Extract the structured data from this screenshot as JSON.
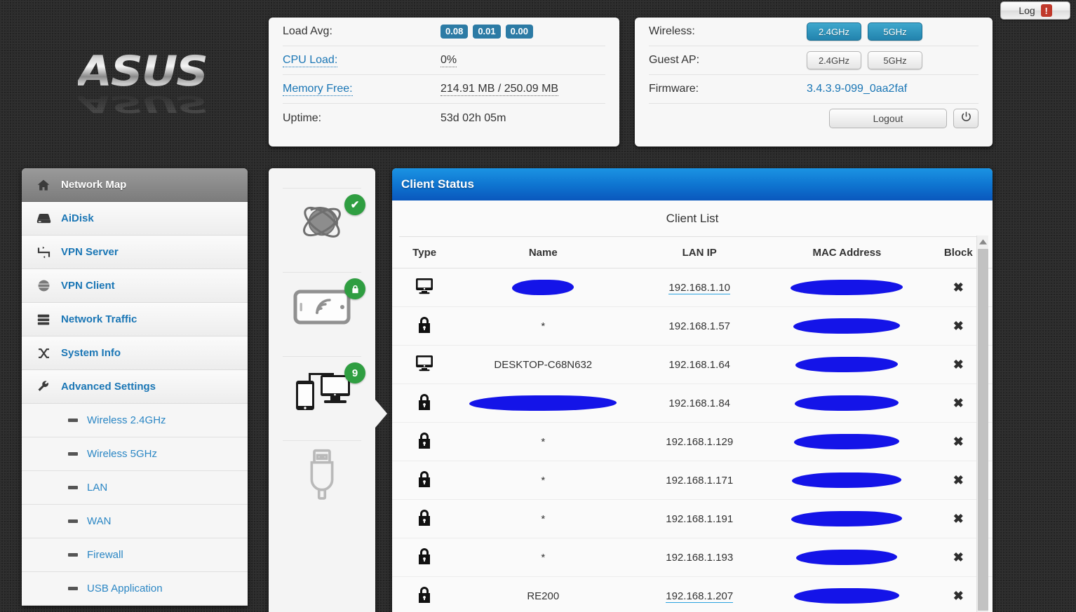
{
  "topbar": {
    "log_label": "Log",
    "log_badge": "!"
  },
  "brand": {
    "logo_text": "ASUS"
  },
  "status_panel": {
    "load_avg_label": "Load Avg:",
    "load_avg_values": [
      "0.08",
      "0.01",
      "0.00"
    ],
    "cpu_load_label": "CPU Load:",
    "cpu_load_value": "0%",
    "memory_label": "Memory Free:",
    "memory_value": "214.91 MB / 250.09 MB",
    "uptime_label": "Uptime:",
    "uptime_value": "53d 02h 05m"
  },
  "wireless_panel": {
    "wireless_label": "Wireless:",
    "wireless_bands": [
      {
        "label": "2.4GHz",
        "active": true
      },
      {
        "label": "5GHz",
        "active": true
      }
    ],
    "guest_label": "Guest AP:",
    "guest_bands": [
      {
        "label": "2.4GHz",
        "active": false
      },
      {
        "label": "5GHz",
        "active": false
      }
    ],
    "firmware_label": "Firmware:",
    "firmware_value": "3.4.3.9-099_0aa2faf",
    "logout_label": "Logout",
    "power_icon": "power-icon"
  },
  "sidebar": {
    "items": [
      {
        "label": "Network Map",
        "icon": "home-icon",
        "active": true
      },
      {
        "label": "AiDisk",
        "icon": "harddisk-icon",
        "active": false
      },
      {
        "label": "VPN Server",
        "icon": "vpn-server-icon",
        "active": false
      },
      {
        "label": "VPN Client",
        "icon": "globe-icon",
        "active": false
      },
      {
        "label": "Network Traffic",
        "icon": "traffic-icon",
        "active": false
      },
      {
        "label": "System Info",
        "icon": "shuffle-icon",
        "active": false
      },
      {
        "label": "Advanced Settings",
        "icon": "wrench-icon",
        "active": false
      }
    ],
    "sub_items": [
      {
        "label": "Wireless 2.4GHz"
      },
      {
        "label": "Wireless 5GHz"
      },
      {
        "label": "LAN"
      },
      {
        "label": "WAN"
      },
      {
        "label": "Firewall"
      },
      {
        "label": "USB Application"
      }
    ]
  },
  "topology": {
    "nodes": [
      {
        "icon": "internet-globe-icon",
        "badge": "✔",
        "badge_type": "check"
      },
      {
        "icon": "wireless-router-icon",
        "badge": "lock",
        "badge_type": "lock"
      },
      {
        "icon": "clients-devices-icon",
        "badge": "9",
        "badge_type": "count"
      },
      {
        "icon": "usb-icon",
        "badge": "",
        "badge_type": "none"
      }
    ]
  },
  "client_status": {
    "title": "Client Status",
    "list_title": "Client List",
    "columns": [
      "Type",
      "Name",
      "LAN IP",
      "MAC Address",
      "Block"
    ],
    "rows": [
      {
        "type": "monitor-icon",
        "name": "",
        "name_redacted": true,
        "name_redact_width": 88,
        "ip": "192.168.1.10",
        "ip_link": true,
        "mac": "",
        "mac_redacted": true,
        "mac_redact_width": 160,
        "block": "✖"
      },
      {
        "type": "lock-icon",
        "name": "*",
        "name_redacted": false,
        "ip": "192.168.1.57",
        "ip_link": false,
        "mac": "",
        "mac_redacted": true,
        "mac_redact_width": 152,
        "block": "✖"
      },
      {
        "type": "monitor-icon",
        "name": "DESKTOP-C68N632",
        "name_redacted": false,
        "ip": "192.168.1.64",
        "ip_link": false,
        "mac": "",
        "mac_redacted": true,
        "mac_redact_width": 146,
        "block": "✖"
      },
      {
        "type": "lock-icon",
        "name": "",
        "name_redacted": true,
        "name_redact_width": 210,
        "ip": "192.168.1.84",
        "ip_link": false,
        "mac": "",
        "mac_redacted": true,
        "mac_redact_width": 148,
        "block": "✖"
      },
      {
        "type": "lock-icon",
        "name": "*",
        "name_redacted": false,
        "ip": "192.168.1.129",
        "ip_link": false,
        "mac": "",
        "mac_redacted": true,
        "mac_redact_width": 150,
        "block": "✖"
      },
      {
        "type": "lock-icon",
        "name": "*",
        "name_redacted": false,
        "ip": "192.168.1.171",
        "ip_link": false,
        "mac": "",
        "mac_redacted": true,
        "mac_redact_width": 156,
        "block": "✖"
      },
      {
        "type": "lock-icon",
        "name": "*",
        "name_redacted": false,
        "ip": "192.168.1.191",
        "ip_link": false,
        "mac": "",
        "mac_redacted": true,
        "mac_redact_width": 158,
        "block": "✖"
      },
      {
        "type": "lock-icon",
        "name": "*",
        "name_redacted": false,
        "ip": "192.168.1.193",
        "ip_link": false,
        "mac": "",
        "mac_redacted": true,
        "mac_redact_width": 144,
        "block": "✖"
      },
      {
        "type": "lock-icon",
        "name": "RE200",
        "name_redacted": false,
        "ip": "192.168.1.207",
        "ip_link": true,
        "mac": "",
        "mac_redacted": true,
        "mac_redact_width": 150,
        "block": "✖"
      }
    ]
  },
  "colors": {
    "background": "#2c2c2c",
    "accent_blue": "#1a76b5",
    "header_blue": "#0e73cf",
    "badge_teal": "#2c7ba5",
    "green": "#2f9e41",
    "redact_blue": "#1414e8",
    "link_cyan": "#2aa3e0"
  }
}
